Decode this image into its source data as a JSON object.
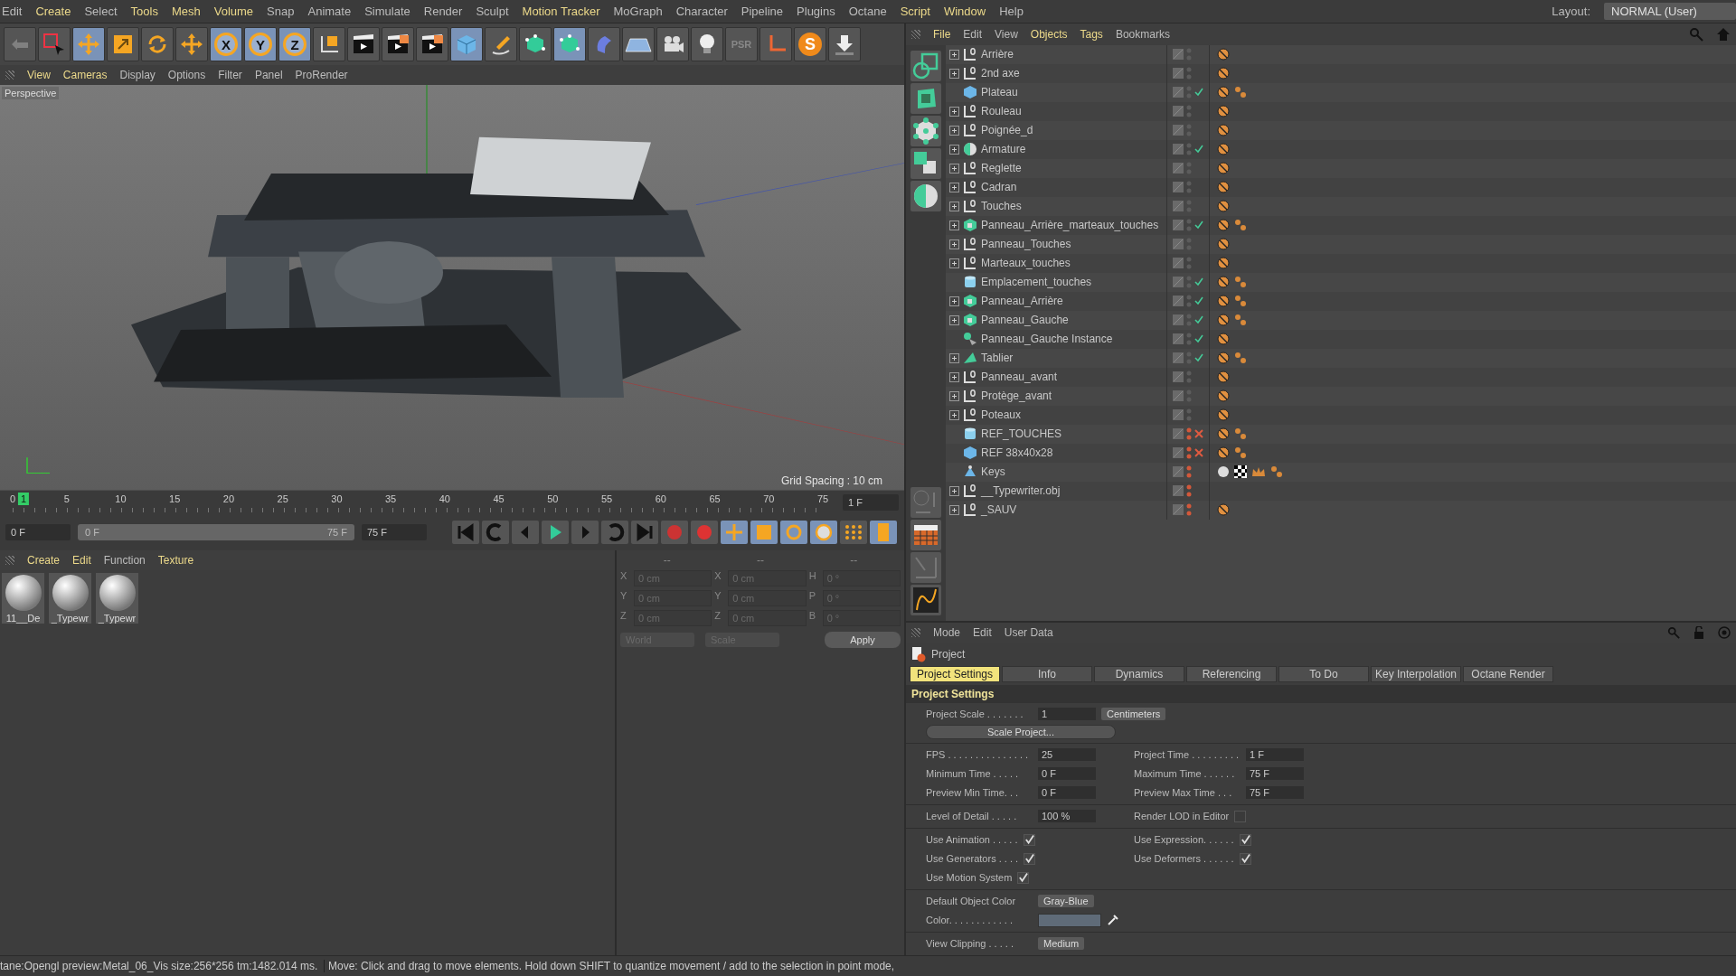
{
  "menu": [
    {
      "label": "Edit",
      "highlighted": false
    },
    {
      "label": "Create",
      "highlighted": true
    },
    {
      "label": "Select",
      "highlighted": false
    },
    {
      "label": "Tools",
      "highlighted": true
    },
    {
      "label": "Mesh",
      "highlighted": true
    },
    {
      "label": "Volume",
      "highlighted": true
    },
    {
      "label": "Snap",
      "highlighted": false
    },
    {
      "label": "Animate",
      "highlighted": false
    },
    {
      "label": "Simulate",
      "highlighted": false
    },
    {
      "label": "Render",
      "highlighted": false
    },
    {
      "label": "Sculpt",
      "highlighted": false
    },
    {
      "label": "Motion Tracker",
      "highlighted": true
    },
    {
      "label": "MoGraph",
      "highlighted": false
    },
    {
      "label": "Character",
      "highlighted": false
    },
    {
      "label": "Pipeline",
      "highlighted": false
    },
    {
      "label": "Plugins",
      "highlighted": false
    },
    {
      "label": "Octane",
      "highlighted": false
    },
    {
      "label": "Script",
      "highlighted": true
    },
    {
      "label": "Window",
      "highlighted": true
    },
    {
      "label": "Help",
      "highlighted": false
    }
  ],
  "layout": {
    "label": "Layout:",
    "value": "NORMAL (User)"
  },
  "toolbar": [
    {
      "kind": "undo",
      "selected": false
    },
    {
      "kind": "select",
      "selected": false
    },
    {
      "kind": "move",
      "selected": true
    },
    {
      "kind": "scale",
      "selected": false
    },
    {
      "kind": "rotate",
      "selected": false
    },
    {
      "kind": "transform",
      "selected": false
    },
    {
      "kind": "axis_letter",
      "label": "X",
      "selected": true
    },
    {
      "kind": "axis_letter",
      "label": "Y",
      "selected": true
    },
    {
      "kind": "axis_letter",
      "label": "Z",
      "selected": true
    },
    {
      "kind": "coords",
      "selected": false
    },
    {
      "kind": "render_view",
      "selected": false
    },
    {
      "kind": "render_picture",
      "selected": false
    },
    {
      "kind": "render_settings",
      "selected": false
    },
    {
      "kind": "cube",
      "selected": true
    },
    {
      "kind": "pen",
      "selected": false
    },
    {
      "kind": "subdivision",
      "selected": false
    },
    {
      "kind": "array",
      "selected": true
    },
    {
      "kind": "deformer",
      "selected": false
    },
    {
      "kind": "floor",
      "selected": false
    },
    {
      "kind": "camera",
      "selected": false
    },
    {
      "kind": "light",
      "selected": false
    },
    {
      "kind": "psr",
      "label": "PSR",
      "selected": false
    },
    {
      "kind": "axis",
      "selected": false
    },
    {
      "kind": "s_logo",
      "label": "S",
      "selected": false
    },
    {
      "kind": "download",
      "selected": false
    }
  ],
  "viewport": {
    "menu": [
      {
        "label": "View",
        "highlighted": true
      },
      {
        "label": "Cameras",
        "highlighted": true
      },
      {
        "label": "Display",
        "highlighted": false
      },
      {
        "label": "Options",
        "highlighted": false
      },
      {
        "label": "Filter",
        "highlighted": false
      },
      {
        "label": "Panel",
        "highlighted": false
      },
      {
        "label": "ProRender",
        "highlighted": false
      }
    ],
    "camera": "Perspective",
    "grid_spacing": "Grid Spacing : 10 cm"
  },
  "timeline": {
    "ticks": [
      "0",
      "5",
      "10",
      "15",
      "20",
      "25",
      "30",
      "35",
      "40",
      "45",
      "50",
      "55",
      "60",
      "65",
      "70",
      "75"
    ],
    "current": "1",
    "frame": "1 F",
    "start": "0 F",
    "range_start": "0 F",
    "range_end": "75 F",
    "end": "75 F"
  },
  "materials": {
    "menu": [
      {
        "label": "Create",
        "highlighted": true
      },
      {
        "label": "Edit",
        "highlighted": true
      },
      {
        "label": "Function",
        "highlighted": false
      },
      {
        "label": "Texture",
        "highlighted": true
      }
    ],
    "items": [
      "11__De",
      "_Typewr",
      "_Typewr"
    ]
  },
  "coordinates": {
    "disabled": true,
    "headers": [
      "--",
      "--",
      "--"
    ],
    "columns": [
      [
        {
          "axis": "X",
          "value": "0 cm"
        },
        {
          "axis": "Y",
          "value": "0 cm"
        },
        {
          "axis": "Z",
          "value": "0 cm"
        }
      ],
      [
        {
          "axis": "X",
          "value": "0 cm"
        },
        {
          "axis": "Y",
          "value": "0 cm"
        },
        {
          "axis": "Z",
          "value": "0 cm"
        }
      ],
      [
        {
          "axis": "H",
          "value": "0 °"
        },
        {
          "axis": "P",
          "value": "0 °"
        },
        {
          "axis": "B",
          "value": "0 °"
        }
      ]
    ],
    "space": "World",
    "mode": "Scale",
    "apply": "Apply"
  },
  "status_bar": {
    "left": "tane:Opengl preview:Metal_06_Vis  size:256*256  tm:1482.014 ms.",
    "right": "Move: Click and drag to move elements. Hold down SHIFT to quantize movement / add to the selection in point mode,"
  },
  "objects": {
    "menu": [
      {
        "label": "File",
        "highlighted": true
      },
      {
        "label": "Edit",
        "highlighted": false
      },
      {
        "label": "View",
        "highlighted": false
      },
      {
        "label": "Objects",
        "highlighted": true
      },
      {
        "label": "Tags",
        "highlighted": true
      },
      {
        "label": "Bookmarks",
        "highlighted": false
      }
    ],
    "rows": [
      {
        "name": "Arrière",
        "kind": "null",
        "expandable": true,
        "hidden": false,
        "tags": [
          {
            "kind": "phong"
          }
        ]
      },
      {
        "name": "2nd axe",
        "kind": "null",
        "expandable": true,
        "hidden": false,
        "tags": [
          {
            "kind": "phong"
          }
        ]
      },
      {
        "name": "Plateau",
        "kind": "cube",
        "expandable": false,
        "hidden": false,
        "enabled": true,
        "tags": [
          {
            "kind": "phong"
          },
          {
            "kind": "selection"
          }
        ]
      },
      {
        "name": "Rouleau",
        "kind": "null",
        "expandable": true,
        "hidden": false,
        "tags": [
          {
            "kind": "phong"
          }
        ]
      },
      {
        "name": "Poignée_d",
        "kind": "null",
        "expandable": true,
        "hidden": false,
        "tags": [
          {
            "kind": "phong"
          }
        ]
      },
      {
        "name": "Armature",
        "kind": "half_sphere",
        "expandable": true,
        "hidden": false,
        "enabled": true,
        "tags": [
          {
            "kind": "phong"
          }
        ]
      },
      {
        "name": "Reglette",
        "kind": "null",
        "expandable": true,
        "hidden": false,
        "tags": [
          {
            "kind": "phong"
          }
        ]
      },
      {
        "name": "Cadran",
        "kind": "null",
        "expandable": true,
        "hidden": false,
        "tags": [
          {
            "kind": "phong"
          }
        ]
      },
      {
        "name": "Touches",
        "kind": "null",
        "expandable": true,
        "hidden": false,
        "tags": [
          {
            "kind": "phong"
          }
        ]
      },
      {
        "name": "Panneau_Arrière_marteaux_touches",
        "kind": "poly",
        "expandable": true,
        "hidden": false,
        "enabled": true,
        "tags": [
          {
            "kind": "phong"
          },
          {
            "kind": "selection"
          }
        ]
      },
      {
        "name": "Panneau_Touches",
        "kind": "null",
        "expandable": true,
        "hidden": false,
        "tags": [
          {
            "kind": "phong"
          }
        ]
      },
      {
        "name": "Marteaux_touches",
        "kind": "null",
        "expandable": true,
        "hidden": false,
        "tags": [
          {
            "kind": "phong"
          }
        ]
      },
      {
        "name": "Emplacement_touches",
        "kind": "cylinder",
        "expandable": false,
        "hidden": false,
        "enabled": true,
        "tags": [
          {
            "kind": "phong"
          },
          {
            "kind": "selection"
          }
        ]
      },
      {
        "name": "Panneau_Arrière",
        "kind": "poly",
        "expandable": true,
        "hidden": false,
        "enabled": true,
        "tags": [
          {
            "kind": "phong"
          },
          {
            "kind": "selection"
          }
        ]
      },
      {
        "name": "Panneau_Gauche",
        "kind": "poly",
        "expandable": true,
        "hidden": false,
        "enabled": true,
        "tags": [
          {
            "kind": "phong"
          },
          {
            "kind": "selection"
          }
        ]
      },
      {
        "name": "Panneau_Gauche Instance",
        "kind": "instance",
        "expandable": false,
        "hidden": false,
        "enabled": true,
        "tags": [
          {
            "kind": "phong"
          }
        ]
      },
      {
        "name": "Tablier",
        "kind": "wedge",
        "expandable": true,
        "hidden": false,
        "enabled": true,
        "tags": [
          {
            "kind": "phong"
          },
          {
            "kind": "selection"
          }
        ]
      },
      {
        "name": "Panneau_avant",
        "kind": "null",
        "expandable": true,
        "hidden": false,
        "tags": [
          {
            "kind": "phong"
          }
        ]
      },
      {
        "name": "Protège_avant",
        "kind": "null",
        "expandable": true,
        "hidden": false,
        "tags": [
          {
            "kind": "phong"
          }
        ]
      },
      {
        "name": "Poteaux",
        "kind": "null",
        "expandable": true,
        "hidden": false,
        "tags": [
          {
            "kind": "phong"
          }
        ]
      },
      {
        "name": "REF_TOUCHES",
        "kind": "cylinder",
        "expandable": false,
        "hidden": true,
        "enabled": false,
        "tags": [
          {
            "kind": "phong"
          },
          {
            "kind": "selection"
          }
        ]
      },
      {
        "name": "REF 38x40x28",
        "kind": "cube",
        "expandable": false,
        "hidden": true,
        "enabled": false,
        "tags": [
          {
            "kind": "phong"
          },
          {
            "kind": "selection"
          }
        ]
      },
      {
        "name": "Keys",
        "kind": "particles",
        "expandable": false,
        "hidden": true,
        "tags": [
          {
            "kind": "material"
          },
          {
            "kind": "checker"
          },
          {
            "kind": "crown"
          },
          {
            "kind": "selection"
          }
        ]
      },
      {
        "name": "__Typewriter.obj",
        "kind": "null",
        "expandable": true,
        "hidden": true
      },
      {
        "name": "_SAUV",
        "kind": "null",
        "expandable": true,
        "hidden": true,
        "tags": [
          {
            "kind": "phong"
          }
        ]
      }
    ]
  },
  "attributes": {
    "menu": [
      {
        "label": "Mode"
      },
      {
        "label": "Edit"
      },
      {
        "label": "User Data"
      }
    ],
    "title": "Project",
    "tabs": [
      {
        "label": "Project Settings",
        "selected": true
      },
      {
        "label": "Info",
        "selected": false
      },
      {
        "label": "Dynamics",
        "selected": false
      },
      {
        "label": "Referencing",
        "selected": false
      },
      {
        "label": "To Do",
        "selected": false
      },
      {
        "label": "Key Interpolation",
        "selected": false
      },
      {
        "label": "Octane Render",
        "selected": false
      }
    ],
    "section": "Project Settings",
    "project_scale": {
      "label": "Project Scale . . . . . . .",
      "value": "1",
      "unit": "Centimeters"
    },
    "scale_button": "Scale Project...",
    "time_fields": [
      {
        "label": "FPS . . . . . . . . . . . . . . .",
        "value": "25"
      },
      {
        "label": "Project Time . . . . . . . . .",
        "value": "1 F"
      },
      {
        "label": "Minimum Time . . . . .",
        "value": "0 F"
      },
      {
        "label": "Maximum Time . . . . . .",
        "value": "75 F"
      },
      {
        "label": "Preview Min Time. . .",
        "value": "0 F"
      },
      {
        "label": "Preview Max Time . . .",
        "value": "75 F"
      }
    ],
    "lod": {
      "label": "Level of Detail . . . . .",
      "value": "100 %"
    },
    "render_lod": {
      "label": "Render LOD in Editor",
      "checked": false
    },
    "checks": [
      {
        "label": "Use Animation . . . . .",
        "checked": true
      },
      {
        "label": "Use Expression. . . . . .",
        "checked": true
      },
      {
        "label": "Use Generators . . . .",
        "checked": true
      },
      {
        "label": "Use Deformers . . . . . .",
        "checked": true
      },
      {
        "label": "Use Motion System",
        "checked": true
      }
    ],
    "default_color": {
      "label": "Default Object Color",
      "value": "Gray-Blue"
    },
    "color": {
      "label": "Color. . . . . . . . . . . .",
      "color": "#5f6b78"
    },
    "view_clipping": {
      "label": "View Clipping . . . . .",
      "value": "Medium"
    }
  }
}
